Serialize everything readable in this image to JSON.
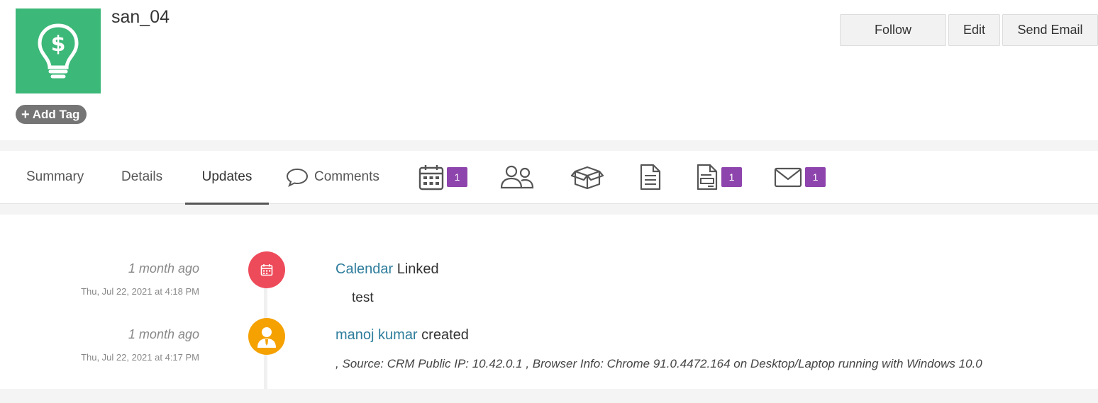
{
  "record": {
    "title": "san_04",
    "add_tag_label": "Add Tag",
    "avatar_icon": "lightbulb-dollar-icon"
  },
  "actions": {
    "follow": "Follow",
    "edit": "Edit",
    "send_email": "Send Email"
  },
  "tabs": {
    "summary": "Summary",
    "details": "Details",
    "updates": "Updates",
    "comments": "Comments",
    "calendar_badge": "1",
    "quotes_badge": "1",
    "emails_badge": "1"
  },
  "updates": [
    {
      "relative_time": "1 month ago",
      "absolute_time": "Thu, Jul 22, 2021 at 4:18 PM",
      "link": "Calendar",
      "action": " Linked",
      "detail": "test",
      "icon": "calendar-icon",
      "color": "#ee4b5a"
    },
    {
      "relative_time": "1 month ago",
      "absolute_time": "Thu, Jul 22, 2021 at 4:17 PM",
      "link": "manoj kumar",
      "action": " created",
      "detail": ", Source: CRM Public IP: 10.42.0.1 , Browser Info: Chrome 91.0.4472.164 on Desktop/Laptop running with Windows 10.0",
      "icon": "user-icon",
      "color": "#f5a100"
    }
  ],
  "colors": {
    "avatar_bg": "#3cb878",
    "badge": "#8e44ad",
    "link": "#2e7d9c"
  }
}
